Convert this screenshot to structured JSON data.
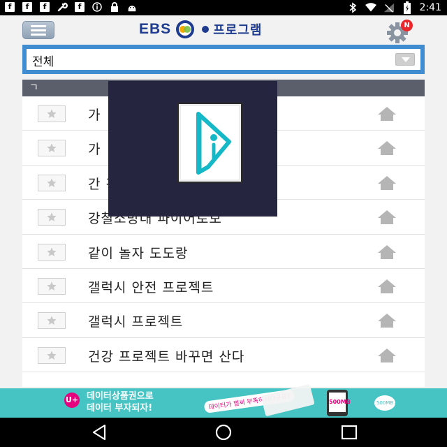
{
  "status_bar": {
    "left_icons": [
      "facebook-icon",
      "facebook-icon",
      "facebook-icon",
      "wrench-icon",
      "facebook-icon",
      "info-icon",
      "lock-icon",
      "android-icon"
    ],
    "right_icons": [
      "bluetooth-icon",
      "wifi-icon",
      "no-signal-icon",
      "battery-icon"
    ],
    "time": "2:41"
  },
  "header": {
    "logo_ebs": "EBS",
    "logo_title": "프로그램",
    "menu_icon": "hamburger-menu-icon",
    "settings_icon": "gear-icon",
    "settings_badge": "N"
  },
  "filter": {
    "selected": "전체"
  },
  "list": {
    "section_header": "ㄱ",
    "items": [
      {
        "title": "가"
      },
      {
        "title": "가"
      },
      {
        "title": "간                               강좌"
      },
      {
        "title": "강철소방대 파이어로보"
      },
      {
        "title": "같이 놀자 도도랑"
      },
      {
        "title": "갤럭시 안전 프로젝트"
      },
      {
        "title": "갤럭시 프로젝트"
      },
      {
        "title": "건강 프로젝트 바꾸면 산다"
      }
    ]
  },
  "loading": {
    "icon": "loading-logo-icon"
  },
  "ad": {
    "line1": "데이터상품권으로",
    "line2": "데이터 부자되자!",
    "bubble": "데이터가 벌써 부족하시다구요?",
    "phone_text": "500MB",
    "coin_text": "500MB",
    "brand_text": "U+"
  },
  "colors": {
    "accent_blue": "#3f8cd1",
    "section_gray": "#5b5f6b",
    "ad_teal": "#46c4c4",
    "brand_navy": "#1d3b8f"
  }
}
